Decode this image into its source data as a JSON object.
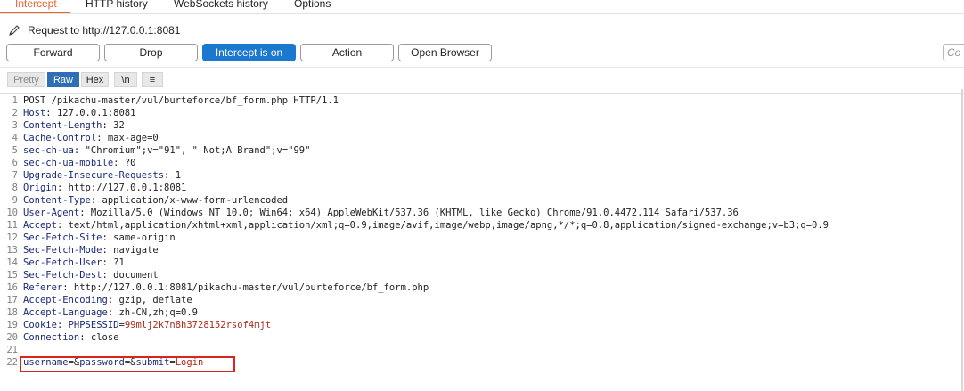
{
  "tabs": [
    {
      "label": "Intercept",
      "active": true
    },
    {
      "label": "HTTP history",
      "active": false
    },
    {
      "label": "WebSockets history",
      "active": false
    },
    {
      "label": "Options",
      "active": false
    }
  ],
  "request_line": "Request to http://127.0.0.1:8081",
  "toolbar": {
    "forward": "Forward",
    "drop": "Drop",
    "intercept": "Intercept is on",
    "action": "Action",
    "open_browser": "Open Browser",
    "comment_placeholder": "Co"
  },
  "editor_toolbar": {
    "pretty": "Pretty",
    "raw": "Raw",
    "hex": "Hex",
    "newline": "\\n",
    "menu": "≡"
  },
  "colors": {
    "accent": "#e8652f",
    "primary_button": "#1b78cf",
    "highlight_box": "#d9251d",
    "header_name": "#1a2a7a",
    "cookie_value": "#b0281a"
  },
  "request": {
    "request_line": "POST /pikachu-master/vul/burteforce/bf_form.php HTTP/1.1",
    "headers": [
      {
        "name": "Host",
        "value": "127.0.0.1:8081"
      },
      {
        "name": "Content-Length",
        "value": "32"
      },
      {
        "name": "Cache-Control",
        "value": "max-age=0"
      },
      {
        "name": "sec-ch-ua",
        "value": "\"Chromium\";v=\"91\", \" Not;A Brand\";v=\"99\""
      },
      {
        "name": "sec-ch-ua-mobile",
        "value": "?0"
      },
      {
        "name": "Upgrade-Insecure-Requests",
        "value": "1"
      },
      {
        "name": "Origin",
        "value": "http://127.0.0.1:8081"
      },
      {
        "name": "Content-Type",
        "value": "application/x-www-form-urlencoded"
      },
      {
        "name": "User-Agent",
        "value": "Mozilla/5.0 (Windows NT 10.0; Win64; x64) AppleWebKit/537.36 (KHTML, like Gecko) Chrome/91.0.4472.114 Safari/537.36"
      },
      {
        "name": "Accept",
        "value": "text/html,application/xhtml+xml,application/xml;q=0.9,image/avif,image/webp,image/apng,*/*;q=0.8,application/signed-exchange;v=b3;q=0.9"
      },
      {
        "name": "Sec-Fetch-Site",
        "value": "same-origin"
      },
      {
        "name": "Sec-Fetch-Mode",
        "value": "navigate"
      },
      {
        "name": "Sec-Fetch-User",
        "value": "?1"
      },
      {
        "name": "Sec-Fetch-Dest",
        "value": "document"
      },
      {
        "name": "Referer",
        "value": "http://127.0.0.1:8081/pikachu-master/vul/burteforce/bf_form.php"
      },
      {
        "name": "Accept-Encoding",
        "value": "gzip, deflate"
      },
      {
        "name": "Accept-Language",
        "value": "zh-CN,zh;q=0.9"
      }
    ],
    "cookie": {
      "name": "Cookie",
      "cookie_name": "PHPSESSID",
      "cookie_value": "99mlj2k7n8h3728152rsof4mjt"
    },
    "connection": {
      "name": "Connection",
      "value": "close"
    },
    "body_params": [
      {
        "name": "username",
        "value": ""
      },
      {
        "name": "password",
        "value": ""
      },
      {
        "name": "submit",
        "value": "Login"
      }
    ]
  }
}
